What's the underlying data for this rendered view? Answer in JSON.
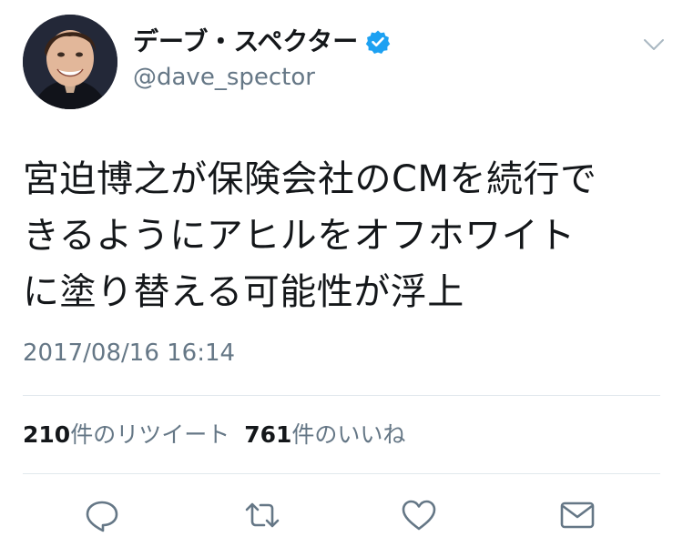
{
  "tweet": {
    "author": {
      "display_name": "デーブ・スペクター",
      "handle": "@dave_spector",
      "verified": true,
      "verified_icon": "verified-badge-icon"
    },
    "menu_icon": "chevron-down-icon",
    "text_lines": [
      "宮迫博之が保険会社のCMを続行で",
      "きるようにアヒルをオフホワイト",
      "に塗り替える可能性が浮上"
    ],
    "timestamp": "2017/08/16 16:14",
    "stats": {
      "retweet_count": "210",
      "retweet_label": "件のリツイート",
      "like_count": "761",
      "like_label": "件のいいね"
    },
    "actions": {
      "reply_icon": "reply-icon",
      "retweet_icon": "retweet-icon",
      "like_icon": "heart-icon",
      "dm_icon": "envelope-icon"
    }
  },
  "colors": {
    "text_primary": "#14171a",
    "text_secondary": "#657786",
    "verified_blue": "#1da1f2",
    "divider": "#e1e8ed"
  }
}
